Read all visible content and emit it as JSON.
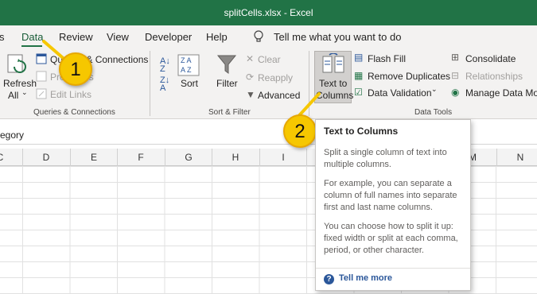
{
  "window": {
    "title": "splitCells.xlsx  -  Excel"
  },
  "menu": {
    "tabs": [
      "s",
      "Data",
      "Review",
      "View",
      "Developer",
      "Help"
    ],
    "active_tab": "Data",
    "tell_me": "Tell me what you want to do"
  },
  "ribbon": {
    "queries": {
      "refresh_all": [
        "Refresh",
        "All"
      ],
      "queries_connections": "Queries & Connections",
      "properties": "Properties",
      "edit_links": "Edit Links",
      "group_label": "Queries & Connections"
    },
    "sort_filter": {
      "sort": "Sort",
      "filter": "Filter",
      "clear": "Clear",
      "reapply": "Reapply",
      "advanced": "Advanced",
      "group_label": "Sort & Filter"
    },
    "data_tools": {
      "text_to_columns": [
        "Text to",
        "Columns"
      ],
      "flash_fill": "Flash Fill",
      "remove_duplicates": "Remove Duplicates",
      "data_validation": "Data Validation",
      "consolidate": "Consolidate",
      "relationships": "Relationships",
      "manage_data_model": "Manage Data Mod",
      "group_label": "Data Tools"
    }
  },
  "formula_bar": {
    "value": "egory"
  },
  "grid": {
    "columns": [
      "C",
      "D",
      "E",
      "F",
      "G",
      "H",
      "I",
      "M",
      "N"
    ]
  },
  "callouts": [
    "1",
    "2"
  ],
  "tooltip": {
    "title": "Text to Columns",
    "paragraphs": [
      "Split a single column of text into multiple columns.",
      "For example, you can separate a column of full names into separate first and last name columns.",
      "You can choose how to split it up: fixed width or split at each comma, period, or other character."
    ],
    "tell_me_more": "Tell me more"
  },
  "colors": {
    "excel_green": "#217346",
    "callout_yellow": "#f6c700",
    "link_blue": "#2b579a"
  }
}
